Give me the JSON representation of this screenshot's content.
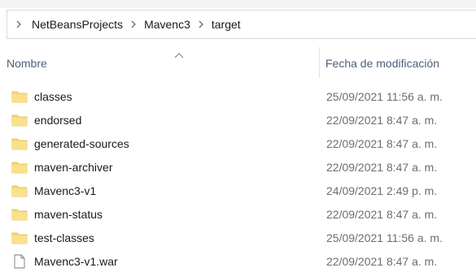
{
  "breadcrumb": {
    "items": [
      "NetBeansProjects",
      "Mavenc3",
      "target"
    ]
  },
  "columns": {
    "name": "Nombre",
    "date": "Fecha de modificación"
  },
  "files": [
    {
      "name": "classes",
      "date": "25/09/2021 11:56 a. m.",
      "type": "folder"
    },
    {
      "name": "endorsed",
      "date": "22/09/2021 8:47 a. m.",
      "type": "folder"
    },
    {
      "name": "generated-sources",
      "date": "22/09/2021 8:47 a. m.",
      "type": "folder"
    },
    {
      "name": "maven-archiver",
      "date": "22/09/2021 8:47 a. m.",
      "type": "folder"
    },
    {
      "name": "Mavenc3-v1",
      "date": "24/09/2021 2:49 p. m.",
      "type": "folder"
    },
    {
      "name": "maven-status",
      "date": "22/09/2021 8:47 a. m.",
      "type": "folder"
    },
    {
      "name": "test-classes",
      "date": "25/09/2021 11:56 a. m.",
      "type": "folder"
    },
    {
      "name": "Mavenc3-v1.war",
      "date": "22/09/2021 8:47 a. m.",
      "type": "file"
    }
  ],
  "colors": {
    "header_text": "#4c607a",
    "date_text": "#6d6d6d",
    "folder": "#f8d775"
  }
}
